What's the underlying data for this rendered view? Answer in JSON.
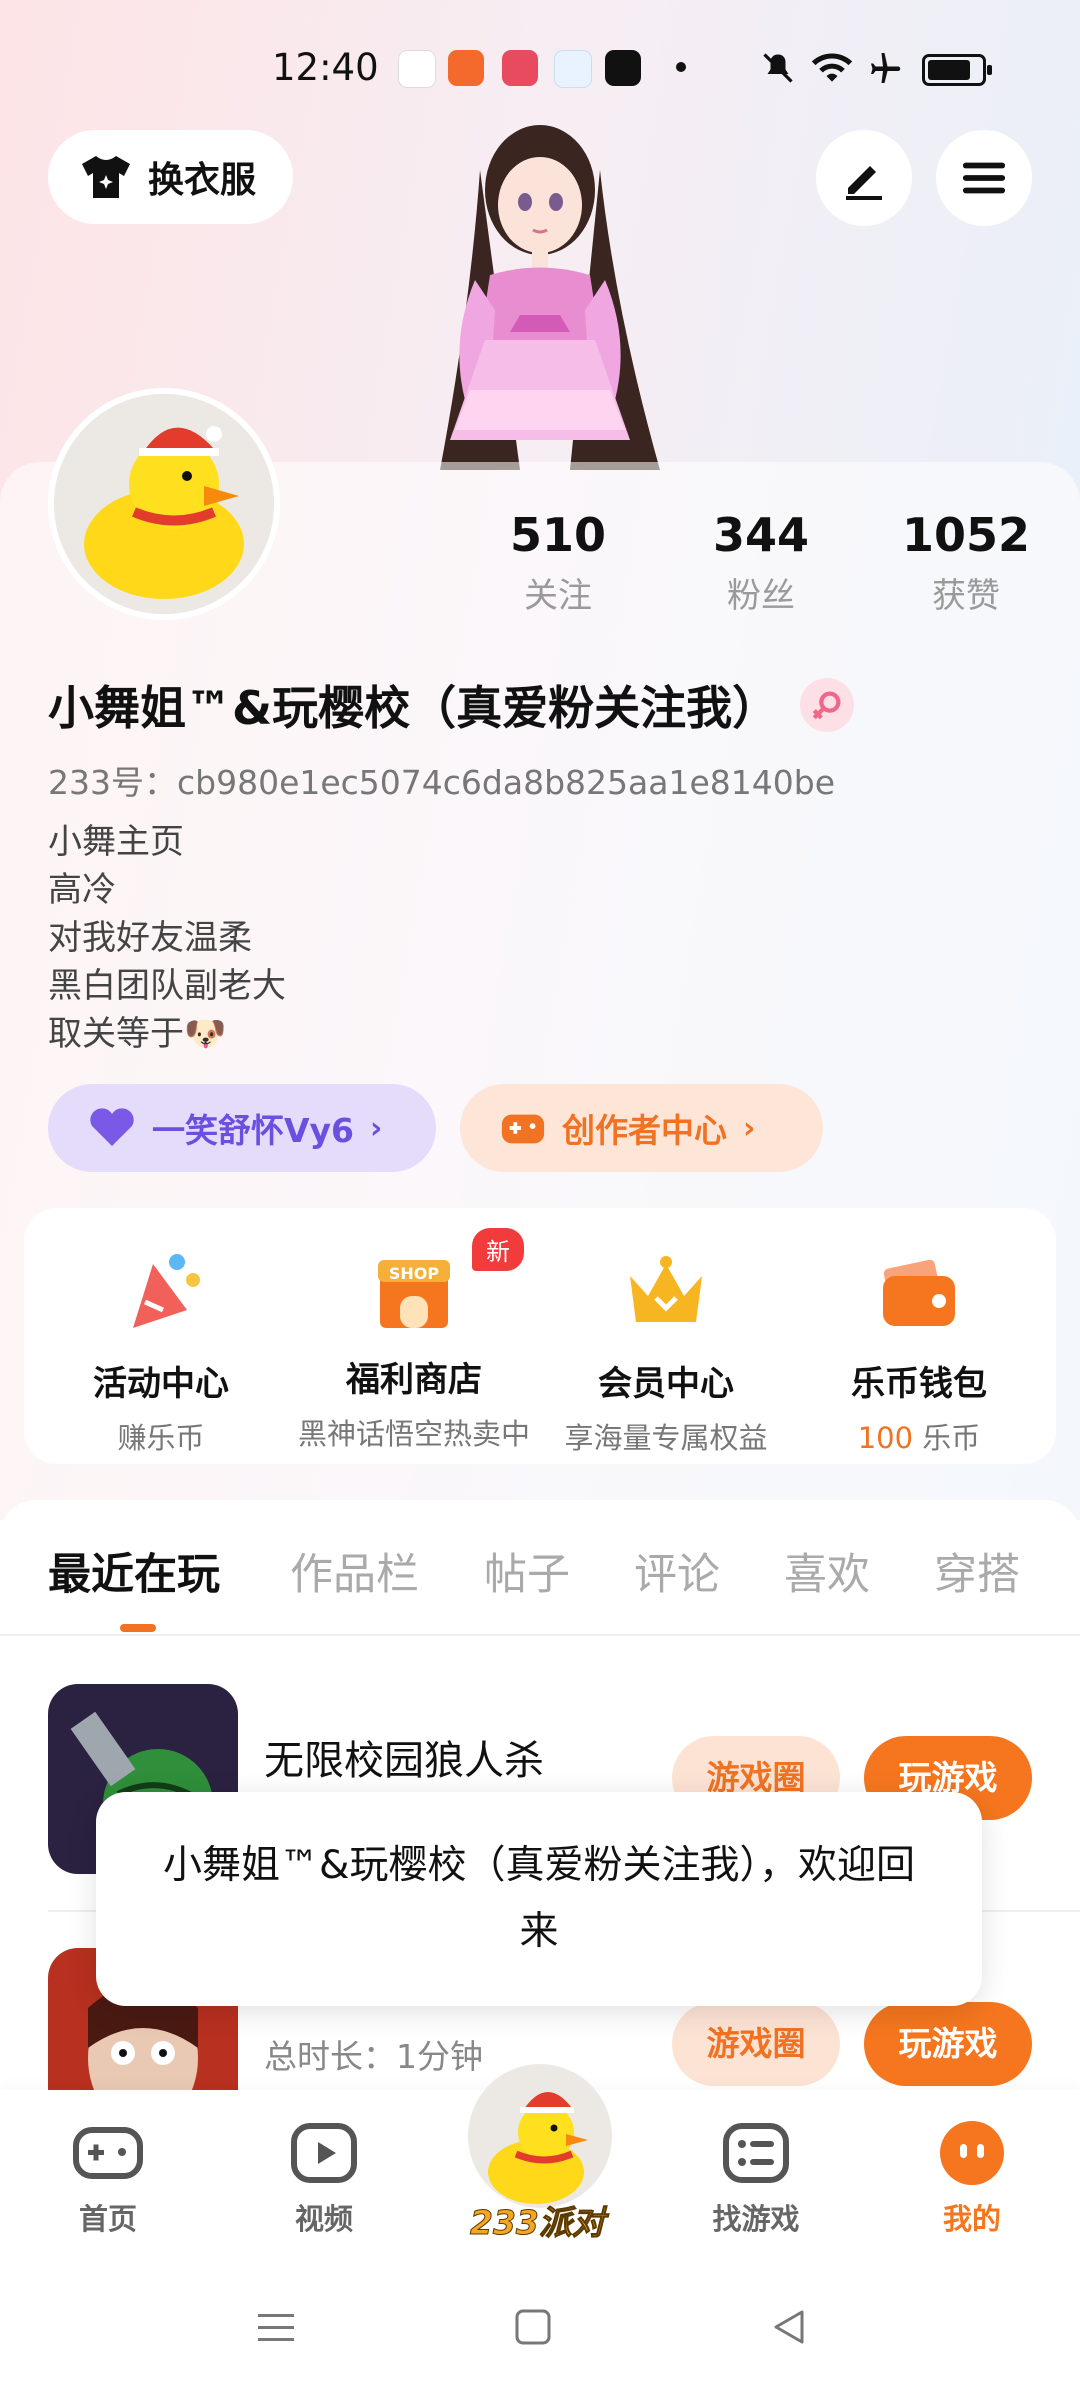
{
  "status_bar": {
    "time": "12:40"
  },
  "top_bar": {
    "outfit_label": "换衣服"
  },
  "stats": [
    {
      "value": "510",
      "label": "关注"
    },
    {
      "value": "344",
      "label": "粉丝"
    },
    {
      "value": "1052",
      "label": "获赞"
    }
  ],
  "profile": {
    "nickname": "小舞姐™&玩樱校（真爱粉关注我）",
    "uid": "233号：cb980e1ec5074c6da8b825aa1e8140be",
    "bio": [
      "小舞主页",
      "高冷",
      "对我好友温柔",
      "黑白团队副老大",
      "取关等于🐶"
    ]
  },
  "pills": {
    "vip_label": "一笑舒怀Vy6",
    "creator_label": "创作者中心"
  },
  "features": [
    {
      "title": "活动中心",
      "subtitle": "赚乐币"
    },
    {
      "title": "福利商店",
      "subtitle": "黑神话悟空热卖中",
      "badge": "新",
      "icon_text": "SHOP"
    },
    {
      "title": "会员中心",
      "subtitle": "享海量专属权益"
    },
    {
      "title": "乐币钱包",
      "subtitle_value": "100",
      "subtitle_unit": " 乐币"
    }
  ],
  "tabs": [
    "最近在玩",
    "作品栏",
    "帖子",
    "评论",
    "喜欢",
    "穿搭"
  ],
  "games": [
    {
      "name": "无限校园狼人杀",
      "circle_label": "游戏圈",
      "play_label": "玩游戏"
    },
    {
      "name": "",
      "time": "总时长：1分钟",
      "circle_label": "游戏圈",
      "play_label": "玩游戏"
    }
  ],
  "toast": {
    "message": "小舞姐™&玩樱校（真爱粉关注我），欢迎回来"
  },
  "bottom_nav": {
    "home": "首页",
    "video": "视频",
    "party": "233派对",
    "find_game": "找游戏",
    "mine": "我的"
  },
  "colors": {
    "accent": "#f5761e",
    "vip": "#6d4fe0"
  }
}
